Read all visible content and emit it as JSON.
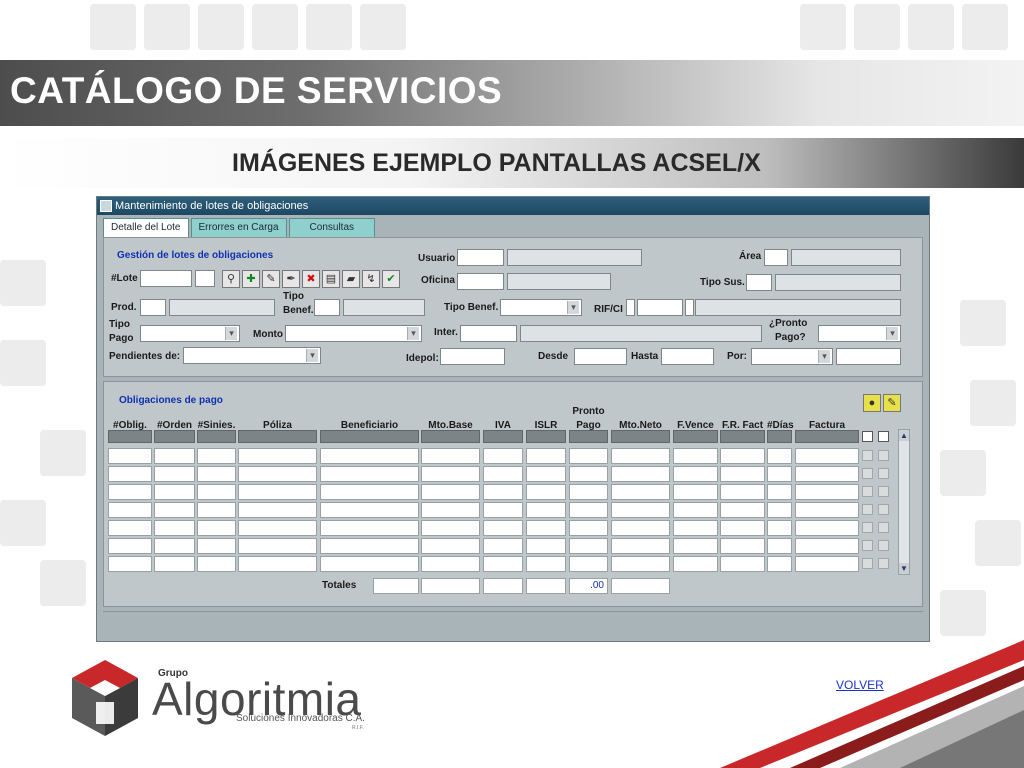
{
  "slide": {
    "title": "CATÁLOGO DE SERVICIOS",
    "subtitle": "IMÁGENES EJEMPLO PANTALLAS ACSEL/X",
    "volver_link": "VOLVER"
  },
  "window": {
    "title": "Mantenimiento de lotes de obligaciones",
    "tabs": [
      {
        "label": "Detalle del Lote",
        "active": true
      },
      {
        "label": "Errorres en Carga",
        "active": false
      },
      {
        "label": "Consultas",
        "active": false
      }
    ]
  },
  "lote_panel": {
    "group_title": "Gestión de lotes de obligaciones",
    "labels": {
      "lote": "#Lote",
      "usuario": "Usuario",
      "area": "Área",
      "oficina": "Oficina",
      "tipo_sus": "Tipo Sus.",
      "prod": "Prod.",
      "tipo_benef_1": "Tipo",
      "tipo_benef_2": "Benef.",
      "tipo_benef_b": "Tipo Benef.",
      "rif_ci": "RIF/CI",
      "tipo_pago_1": "Tipo",
      "tipo_pago_2": "Pago",
      "monto": "Monto",
      "inter": "Inter.",
      "pronto_pago_1": "¿Pronto",
      "pronto_pago_2": "Pago?",
      "pendientes": "Pendientes de:",
      "idepol": "Idepol:",
      "desde": "Desde",
      "hasta": "Hasta",
      "por": "Por:"
    },
    "toolbar": [
      {
        "icon": "binoculars-icon",
        "glyph": "⚲"
      },
      {
        "icon": "add-icon",
        "glyph": "✚"
      },
      {
        "icon": "edit-icon",
        "glyph": "✎"
      },
      {
        "icon": "pen-icon",
        "glyph": "✒"
      },
      {
        "icon": "delete-icon",
        "glyph": "✖"
      },
      {
        "icon": "print-icon",
        "glyph": "▤"
      },
      {
        "icon": "folder-icon",
        "glyph": "▰"
      },
      {
        "icon": "process-icon",
        "glyph": "↯"
      },
      {
        "icon": "check-icon",
        "glyph": "✔"
      }
    ]
  },
  "obligaciones_panel": {
    "group_title": "Obligaciones de pago",
    "columns": [
      "#Oblig.",
      "#Orden",
      "#Sinies.",
      "Póliza",
      "Beneficiario",
      "Mto.Base",
      "IVA",
      "ISLR",
      "Pronto Pago",
      "Mto.Neto",
      "F.Vence",
      "F.R. Fact",
      "#Días",
      "Factura"
    ],
    "pronto_top": "Pronto",
    "pronto_bottom": "Pago",
    "rows_visible": 7,
    "totals_label": "Totales",
    "totals_pronto_pago": ".00",
    "tool_icons": [
      "circle-button-icon",
      "pin-icon"
    ]
  },
  "logo": {
    "grupo": "Grupo",
    "name": "Algoritmia",
    "tagline": "Soluciones Innovadoras C.A.",
    "small": "R.I.F."
  }
}
